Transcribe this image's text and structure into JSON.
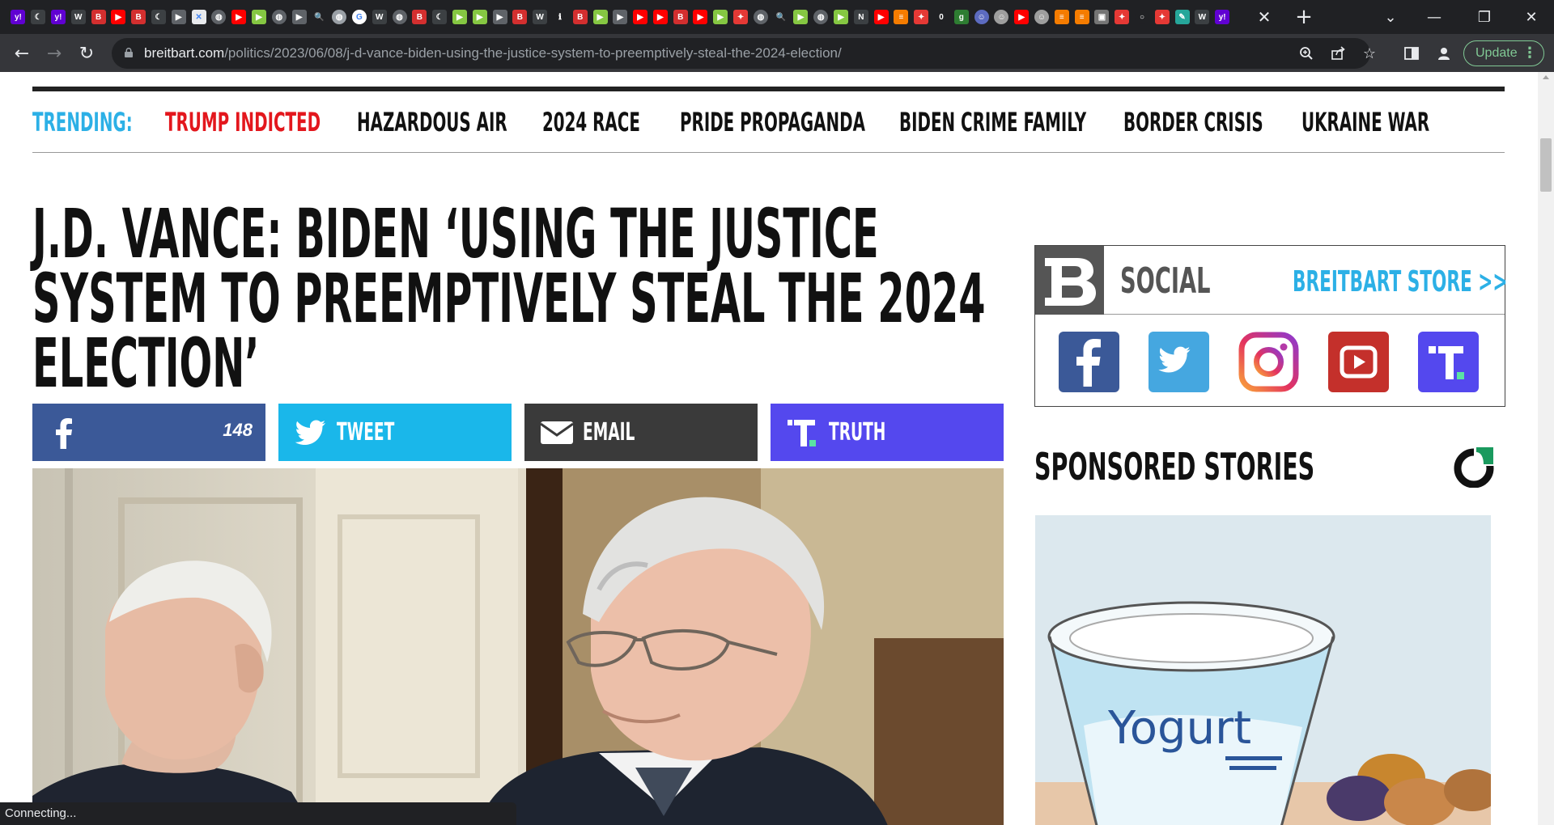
{
  "browser": {
    "tab_favicons": [
      {
        "icon": "yahoo-icon",
        "color": "#6001d2",
        "glyph": "y!"
      },
      {
        "icon": "newspaper-icon",
        "color": "#3c4043",
        "glyph": "☾"
      },
      {
        "icon": "yahoo-icon",
        "color": "#6001d2",
        "glyph": "y!"
      },
      {
        "icon": "wsj-icon",
        "color": "#3c4043",
        "glyph": "W"
      },
      {
        "icon": "breitbart-icon",
        "color": "#d32f2f",
        "glyph": "B"
      },
      {
        "icon": "youtube-icon",
        "color": "#ff0000",
        "glyph": "▶"
      },
      {
        "icon": "breitbart-icon",
        "color": "#d32f2f",
        "glyph": "B"
      },
      {
        "icon": "newspaper-icon",
        "color": "#3c4043",
        "glyph": "☾"
      },
      {
        "icon": "play-icon",
        "color": "#5f6368",
        "glyph": "▶"
      },
      {
        "icon": "map-icon",
        "color": "#e8eaed",
        "glyph": "✕"
      },
      {
        "icon": "globe-icon",
        "color": "#5f6368",
        "glyph": "◍"
      },
      {
        "icon": "youtube-icon",
        "color": "#ff0000",
        "glyph": "▶"
      },
      {
        "icon": "rumble-icon",
        "color": "#85c742",
        "glyph": "▶"
      },
      {
        "icon": "globe-icon",
        "color": "#5f6368",
        "glyph": "◍"
      },
      {
        "icon": "play-icon",
        "color": "#5f6368",
        "glyph": "▶"
      },
      {
        "icon": "search-icon",
        "color": "#202124",
        "glyph": "🔍"
      },
      {
        "icon": "fish-icon",
        "color": "#9aa0a6",
        "glyph": "◍"
      },
      {
        "icon": "google-icon",
        "color": "#ffffff",
        "glyph": "G"
      },
      {
        "icon": "wsj-icon",
        "color": "#3c4043",
        "glyph": "W"
      },
      {
        "icon": "globe-icon",
        "color": "#5f6368",
        "glyph": "◍"
      },
      {
        "icon": "breitbart-icon",
        "color": "#d32f2f",
        "glyph": "B"
      },
      {
        "icon": "newspaper-icon",
        "color": "#3c4043",
        "glyph": "☾"
      },
      {
        "icon": "rumble-icon",
        "color": "#85c742",
        "glyph": "▶"
      },
      {
        "icon": "rumble-icon",
        "color": "#85c742",
        "glyph": "▶"
      },
      {
        "icon": "play-icon",
        "color": "#5f6368",
        "glyph": "▶"
      },
      {
        "icon": "breitbart-icon",
        "color": "#d32f2f",
        "glyph": "B"
      },
      {
        "icon": "wsj-icon",
        "color": "#3c4043",
        "glyph": "W"
      },
      {
        "icon": "text-icon",
        "color": "#202124",
        "glyph": "ℹ"
      },
      {
        "icon": "breitbart-icon",
        "color": "#d32f2f",
        "glyph": "B"
      },
      {
        "icon": "rumble-icon",
        "color": "#85c742",
        "glyph": "▶"
      },
      {
        "icon": "play-icon",
        "color": "#5f6368",
        "glyph": "▶"
      },
      {
        "icon": "youtube-icon",
        "color": "#ff0000",
        "glyph": "▶"
      },
      {
        "icon": "youtube-icon",
        "color": "#ff0000",
        "glyph": "▶"
      },
      {
        "icon": "breitbart-icon",
        "color": "#d32f2f",
        "glyph": "B"
      },
      {
        "icon": "youtube-icon",
        "color": "#ff0000",
        "glyph": "▶"
      },
      {
        "icon": "rumble-icon",
        "color": "#85c742",
        "glyph": "▶"
      },
      {
        "icon": "podcast-icon",
        "color": "#e53935",
        "glyph": "✦"
      },
      {
        "icon": "globe-icon",
        "color": "#5f6368",
        "glyph": "◍"
      },
      {
        "icon": "search-icon",
        "color": "#202124",
        "glyph": "🔍"
      },
      {
        "icon": "rumble-icon",
        "color": "#85c742",
        "glyph": "▶"
      },
      {
        "icon": "globe-icon",
        "color": "#5f6368",
        "glyph": "◍"
      },
      {
        "icon": "rumble-icon",
        "color": "#85c742",
        "glyph": "▶"
      },
      {
        "icon": "news-icon",
        "color": "#3c4043",
        "glyph": "N"
      },
      {
        "icon": "youtube-icon",
        "color": "#ff0000",
        "glyph": "▶"
      },
      {
        "icon": "bookmark-icon",
        "color": "#f57c00",
        "glyph": "≡"
      },
      {
        "icon": "podcast-icon",
        "color": "#e53935",
        "glyph": "✦"
      },
      {
        "icon": "circle-icon",
        "color": "#202124",
        "glyph": "0"
      },
      {
        "icon": "gettr-icon",
        "color": "#2e7d32",
        "glyph": "g"
      },
      {
        "icon": "avatar-icon",
        "color": "#5c6bc0",
        "glyph": "☺"
      },
      {
        "icon": "avatar-icon",
        "color": "#9e9e9e",
        "glyph": "☺"
      },
      {
        "icon": "youtube-icon",
        "color": "#ff0000",
        "glyph": "▶"
      },
      {
        "icon": "avatar-icon",
        "color": "#9e9e9e",
        "glyph": "☺"
      },
      {
        "icon": "bookmark-icon",
        "color": "#f57c00",
        "glyph": "≡"
      },
      {
        "icon": "bookmark-icon",
        "color": "#f57c00",
        "glyph": "≡"
      },
      {
        "icon": "photo-icon",
        "color": "#757575",
        "glyph": "▣"
      },
      {
        "icon": "podcast-icon",
        "color": "#e53935",
        "glyph": "✦"
      },
      {
        "icon": "circle-icon",
        "color": "#202124",
        "glyph": "○"
      },
      {
        "icon": "podcast-icon",
        "color": "#e53935",
        "glyph": "✦"
      },
      {
        "icon": "apps-icon",
        "color": "#26a69a",
        "glyph": "✎"
      },
      {
        "icon": "wsj-icon",
        "color": "#3c4043",
        "glyph": "W"
      },
      {
        "icon": "yahoo-icon",
        "color": "#6001d2",
        "glyph": "y!"
      }
    ],
    "address": {
      "host": "breitbart.com",
      "path": "/politics/2023/06/08/j-d-vance-biden-using-the-justice-system-to-preemptively-steal-the-2024-election/"
    },
    "update_label": "Update",
    "status_text": "Connecting..."
  },
  "trending": {
    "label": "TRENDING:",
    "items": [
      {
        "text": "TRUMP INDICTED"
      },
      {
        "text": "HAZARDOUS AIR"
      },
      {
        "text": "2024 RACE"
      },
      {
        "text": "PRIDE PROPAGANDA"
      },
      {
        "text": "BIDEN CRIME FAMILY"
      },
      {
        "text": "BORDER CRISIS"
      },
      {
        "text": "UKRAINE WAR"
      }
    ]
  },
  "article": {
    "headline_lines": [
      "J.D. VANCE: BIDEN ‘USING THE JUSTICE",
      "SYSTEM TO PREEMPTIVELY STEAL THE 2024",
      "ELECTION’"
    ],
    "share": {
      "facebook_count": "148",
      "tweet_label": "TWEET",
      "email_label": "EMAIL",
      "truth_label": "TRUTH"
    }
  },
  "sidebar": {
    "social_title": "SOCIAL",
    "store_link": "BREITBART STORE >>",
    "sponsored_title": "SPONSORED STORIES",
    "sponsored_image_text": "Yogurt"
  },
  "colors": {
    "facebook": "#3b5998",
    "twitter": "#1ab7ea",
    "email": "#3a3a3a",
    "truth": "#5448ee",
    "trending_accent": "#2cb0e6",
    "trending_hot": "#e3171d",
    "youtube": "#c4302b"
  }
}
